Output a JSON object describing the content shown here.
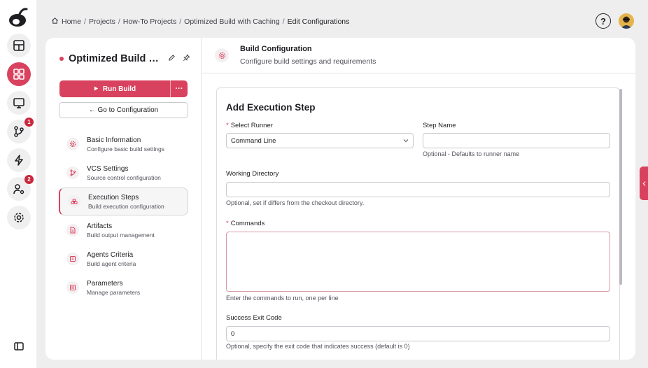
{
  "breadcrumb": [
    "Home",
    "Projects",
    "How-To Projects",
    "Optimized Build with Caching",
    "Edit Configurations"
  ],
  "rail": {
    "badges": {
      "vcs": "1",
      "agents": "2"
    }
  },
  "topbar": {
    "help_label": "?"
  },
  "sidebar": {
    "title": "Optimized Build wi...",
    "run_label": "Run Build",
    "more_label": "···",
    "goto_label": "← Go to Configuration",
    "items": [
      {
        "label": "Basic Information",
        "desc": "Configure basic build settings",
        "icon": "gear-icon"
      },
      {
        "label": "VCS Settings",
        "desc": "Source control configuration",
        "icon": "branch-icon"
      },
      {
        "label": "Execution Steps",
        "desc": "Build execution configuration",
        "icon": "steps-icon"
      },
      {
        "label": "Artifacts",
        "desc": "Build output management",
        "icon": "file-icon"
      },
      {
        "label": "Agents Criteria",
        "desc": "Build agent criteria",
        "icon": "agent-icon"
      },
      {
        "label": "Parameters",
        "desc": "Manage parameters",
        "icon": "sliders-icon"
      }
    ],
    "active_index": 2
  },
  "header": {
    "title": "Build Configuration",
    "subtitle": "Configure build settings and requirements"
  },
  "form": {
    "heading": "Add Execution Step",
    "runner": {
      "label": "Select Runner",
      "value": "Command Line"
    },
    "step_name": {
      "label": "Step Name",
      "value": "",
      "hint": "Optional - Defaults to runner name"
    },
    "working_dir": {
      "label": "Working Directory",
      "value": "",
      "hint": "Optional, set if differs from the checkout directory."
    },
    "commands": {
      "label": "Commands",
      "value": "",
      "hint": "Enter the commands to run, one per line"
    },
    "exit_code": {
      "label": "Success Exit Code",
      "value": "0",
      "hint": "Optional, specify the exit code that indicates success (default is 0)"
    }
  },
  "colors": {
    "accent": "#d9425e",
    "background": "#efeeef"
  }
}
